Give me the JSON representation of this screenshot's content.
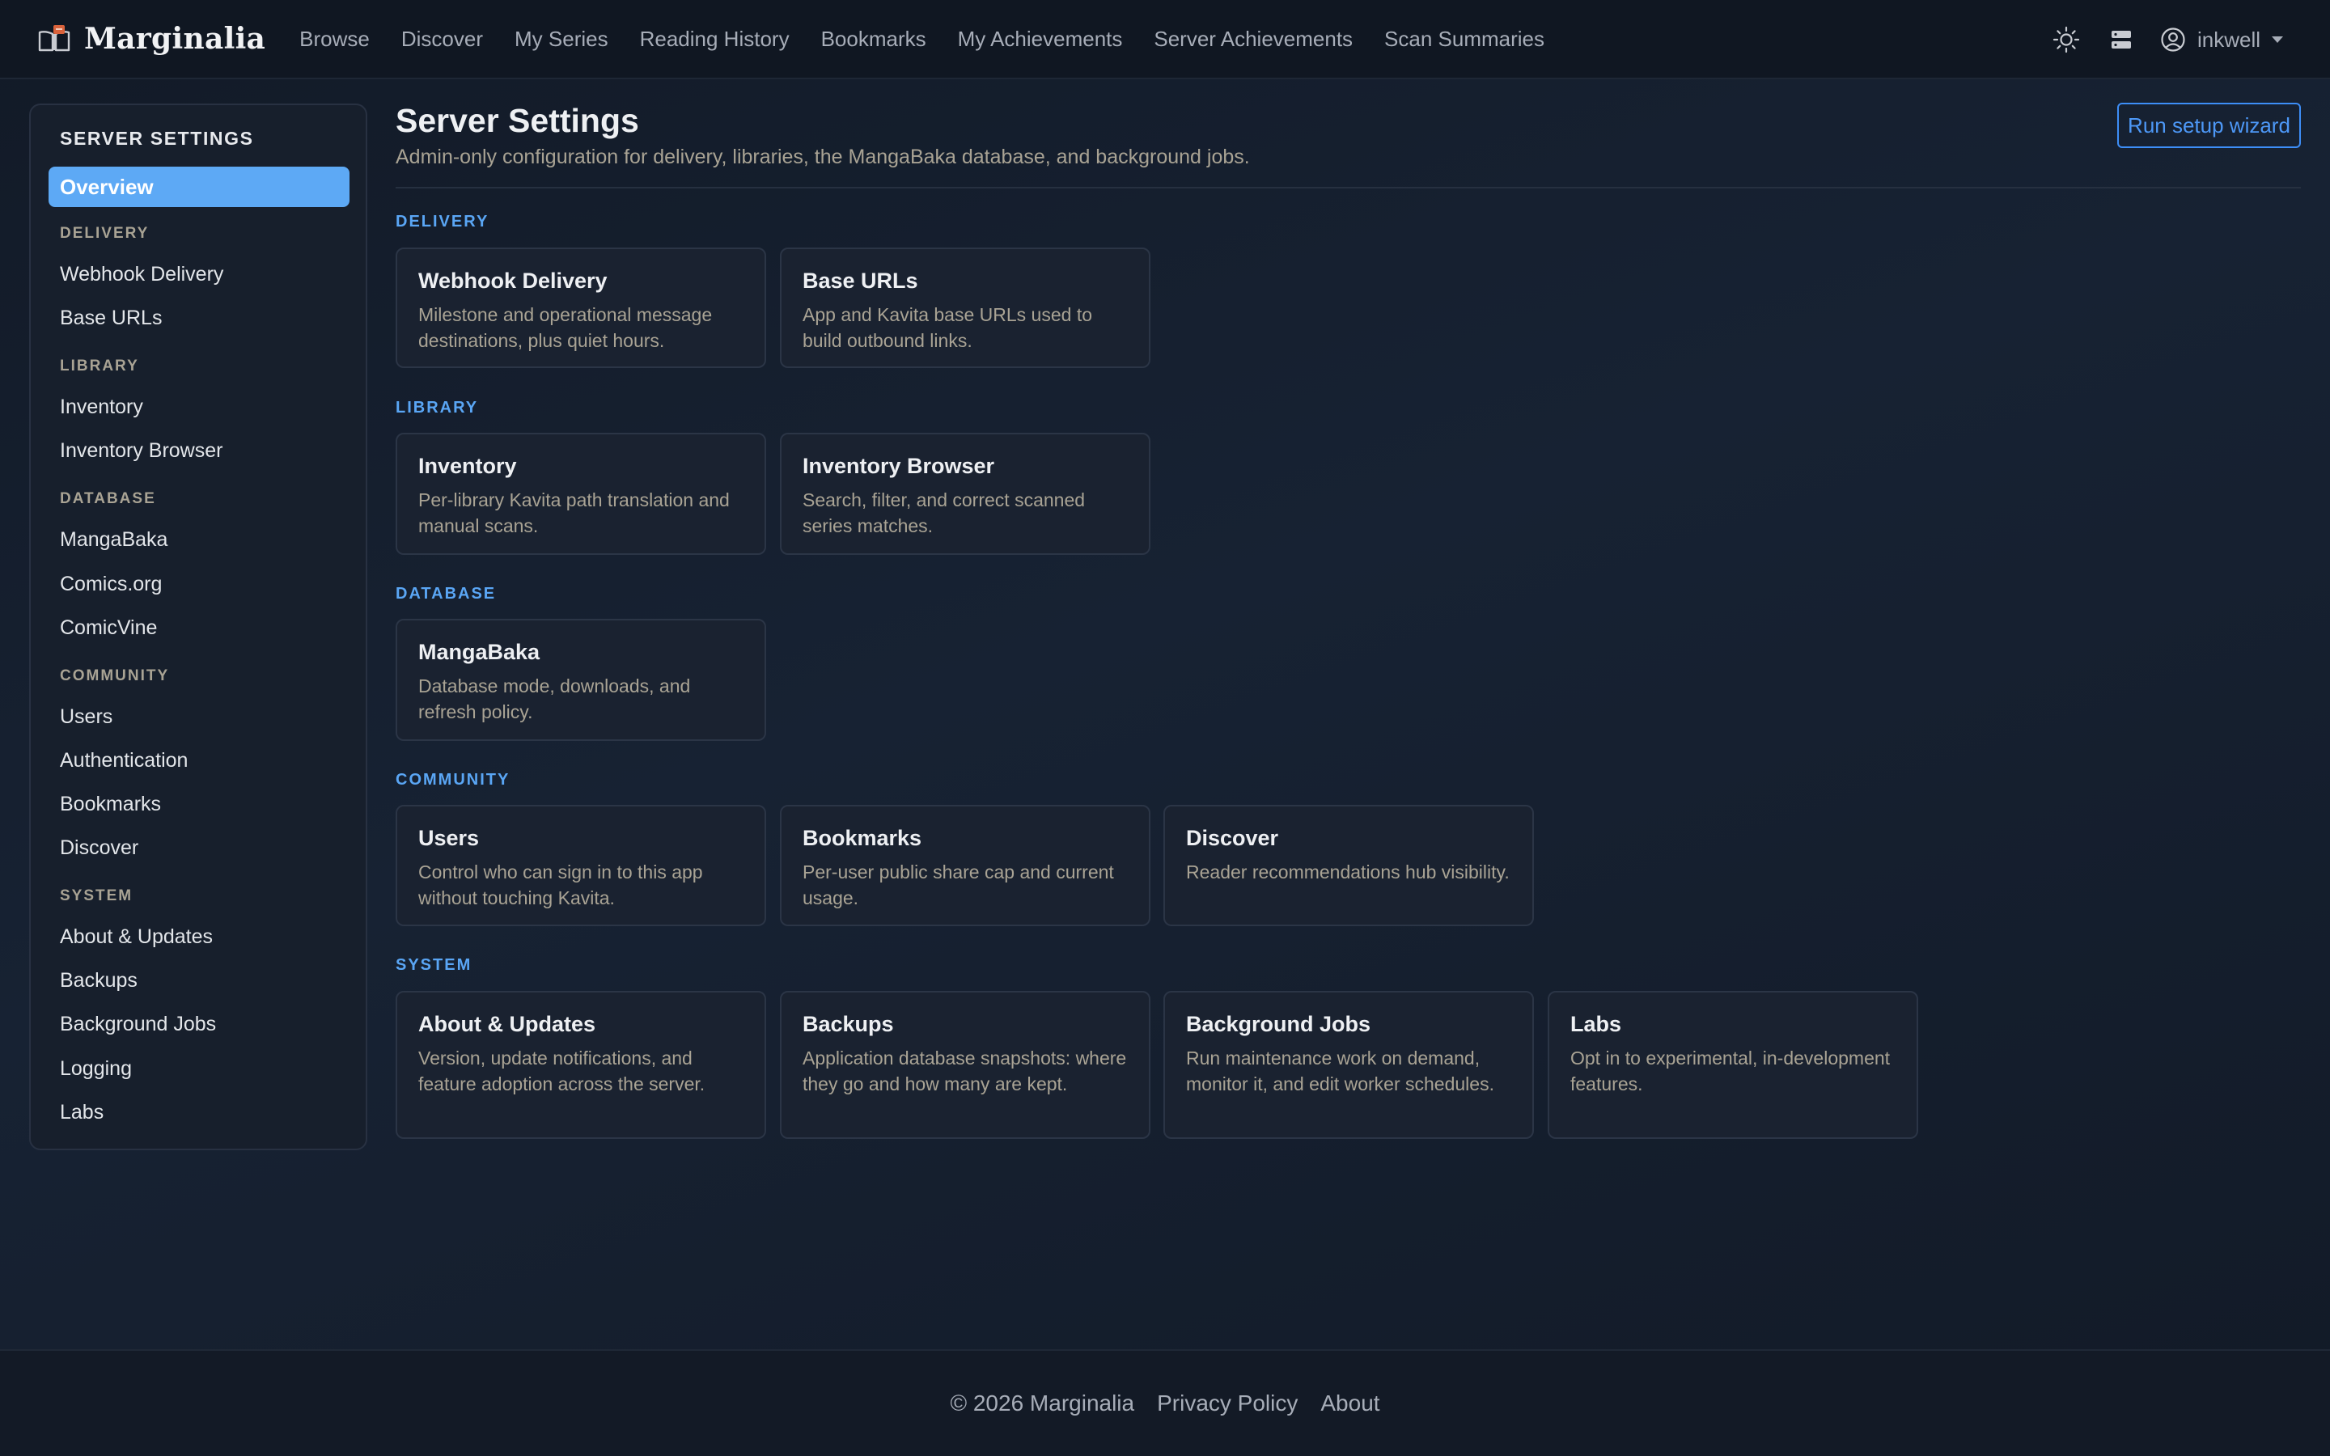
{
  "app": {
    "brand_name": "Marginalia",
    "logo_icon": "open-book-icon",
    "accent": "#5da9f5"
  },
  "nav": {
    "links": [
      "Browse",
      "Discover",
      "My Series",
      "Reading History",
      "Bookmarks",
      "My Achievements",
      "Server Achievements",
      "Scan Summaries"
    ],
    "theme_icon": "sun-icon",
    "server_icon": "server-icon",
    "user_icon": "user-circle-icon",
    "username": "inkwell"
  },
  "sidebar": {
    "title": "SERVER SETTINGS",
    "active": "Overview",
    "groups": [
      {
        "label": "DELIVERY",
        "items": [
          "Webhook Delivery",
          "Base URLs"
        ]
      },
      {
        "label": "LIBRARY",
        "items": [
          "Inventory",
          "Inventory Browser"
        ]
      },
      {
        "label": "DATABASE",
        "items": [
          "MangaBaka",
          "Comics.org",
          "ComicVine"
        ]
      },
      {
        "label": "COMMUNITY",
        "items": [
          "Users",
          "Authentication",
          "Bookmarks",
          "Discover"
        ]
      },
      {
        "label": "SYSTEM",
        "items": [
          "About & Updates",
          "Backups",
          "Background Jobs",
          "Logging",
          "Labs"
        ]
      }
    ]
  },
  "main": {
    "title": "Server Settings",
    "subtitle": "Admin-only configuration for delivery, libraries, the MangaBaka database, and background jobs.",
    "wizard_button": "Run setup wizard",
    "sections": [
      {
        "label": "DELIVERY",
        "cards": [
          {
            "title": "Webhook Delivery",
            "desc": "Milestone and operational message destinations, plus quiet hours."
          },
          {
            "title": "Base URLs",
            "desc": "App and Kavita base URLs used to build outbound links."
          }
        ]
      },
      {
        "label": "LIBRARY",
        "cards": [
          {
            "title": "Inventory",
            "desc": "Per-library Kavita path translation and manual scans."
          },
          {
            "title": "Inventory Browser",
            "desc": "Search, filter, and correct scanned series matches."
          }
        ]
      },
      {
        "label": "DATABASE",
        "cards": [
          {
            "title": "MangaBaka",
            "desc": "Database mode, downloads, and refresh policy."
          }
        ]
      },
      {
        "label": "COMMUNITY",
        "cards": [
          {
            "title": "Users",
            "desc": "Control who can sign in to this app without touching Kavita."
          },
          {
            "title": "Bookmarks",
            "desc": "Per-user public share cap and current usage."
          },
          {
            "title": "Discover",
            "desc": "Reader recommendations hub visibility."
          }
        ]
      },
      {
        "label": "SYSTEM",
        "cards": [
          {
            "title": "About & Updates",
            "desc": "Version, update notifications, and feature adoption across the server."
          },
          {
            "title": "Backups",
            "desc": "Application database snapshots: where they go and how many are kept."
          },
          {
            "title": "Background Jobs",
            "desc": "Run maintenance work on demand, monitor it, and edit worker schedules."
          },
          {
            "title": "Labs",
            "desc": "Opt in to experimental, in-development features."
          }
        ]
      }
    ]
  },
  "footer": {
    "copyright": "© 2026 Marginalia",
    "privacy": "Privacy Policy",
    "about": "About"
  }
}
